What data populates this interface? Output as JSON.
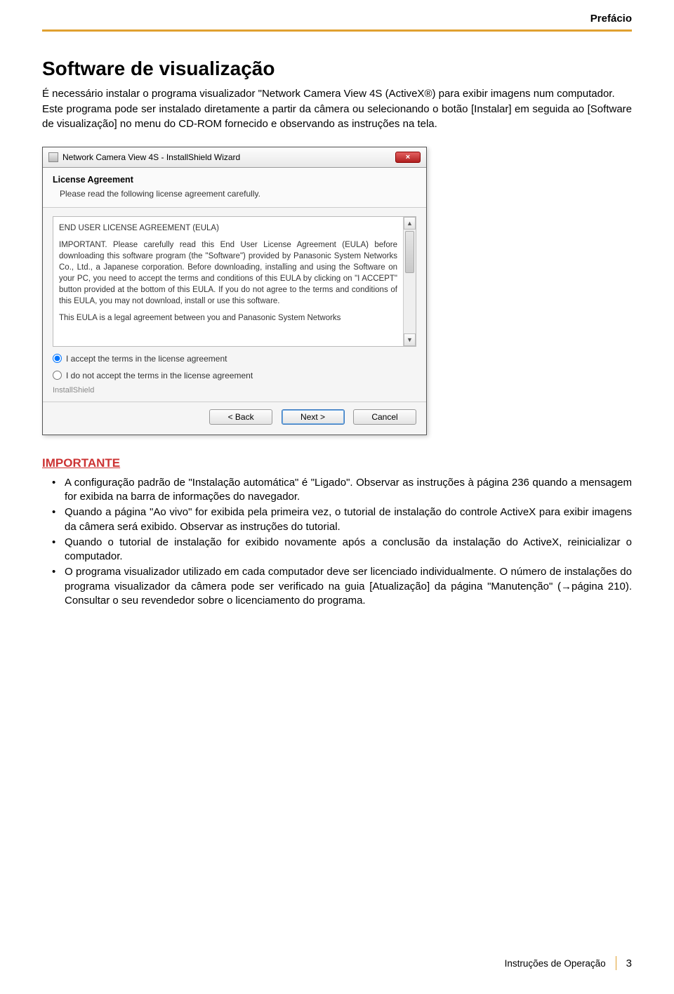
{
  "header": {
    "section": "Prefácio"
  },
  "title": "Software de visualização",
  "intro": [
    "É necessário instalar o programa visualizador \"Network Camera View 4S (ActiveX®) para exibir imagens num computador.",
    "Este programa pode ser instalado diretamente a partir da câmera ou selecionando o botão [Instalar] em seguida ao [Software de visualização] no menu do CD-ROM fornecido e observando as instruções na tela."
  ],
  "wizard": {
    "title": "Network Camera View 4S - InstallShield Wizard",
    "close": "×",
    "header_title": "License Agreement",
    "header_sub": "Please read the following license agreement carefully.",
    "eula_title": "END USER LICENSE AGREEMENT (EULA)",
    "eula_p1": "IMPORTANT.  Please carefully read this End User License Agreement (EULA) before downloading this software program (the \"Software\") provided by Panasonic System Networks Co., Ltd., a Japanese corporation.  Before downloading, installing and using the Software on your PC, you need to accept the terms and conditions of this EULA by clicking on \"I ACCEPT\" button provided at the bottom of this EULA.  If you do not agree to the terms and conditions of this EULA, you may not download, install or use this software.",
    "eula_p2": "This EULA is a legal agreement between you and Panasonic System Networks",
    "radio_accept": "I accept the terms in the license agreement",
    "radio_decline": "I do not accept the terms in the license agreement",
    "brand": "InstallShield",
    "btn_back": "< Back",
    "btn_next": "Next >",
    "btn_cancel": "Cancel"
  },
  "important_heading": "IMPORTANTE",
  "important_items": [
    "A configuração padrão de \"Instalação automática\" é \"Ligado\". Observar as instruções à página 236 quando a mensagem for exibida na barra de informações do navegador.",
    "Quando a página \"Ao vivo\" for exibida pela primeira vez, o tutorial de instalação do controle ActiveX para exibir imagens da câmera será exibido. Observar as instruções do tutorial.",
    "Quando o tutorial de instalação for exibido novamente após a conclusão da instalação do ActiveX, reinicializar o computador.",
    "O programa visualizador utilizado em cada computador deve ser licenciado individualmente. O número de instalações do programa visualizador da câmera pode ser verificado na guia [Atualização] da página \"Manutenção\" (→página 210). Consultar o seu revendedor sobre o licenciamento do programa."
  ],
  "footer": {
    "label": "Instruções de Operação",
    "page": "3"
  }
}
